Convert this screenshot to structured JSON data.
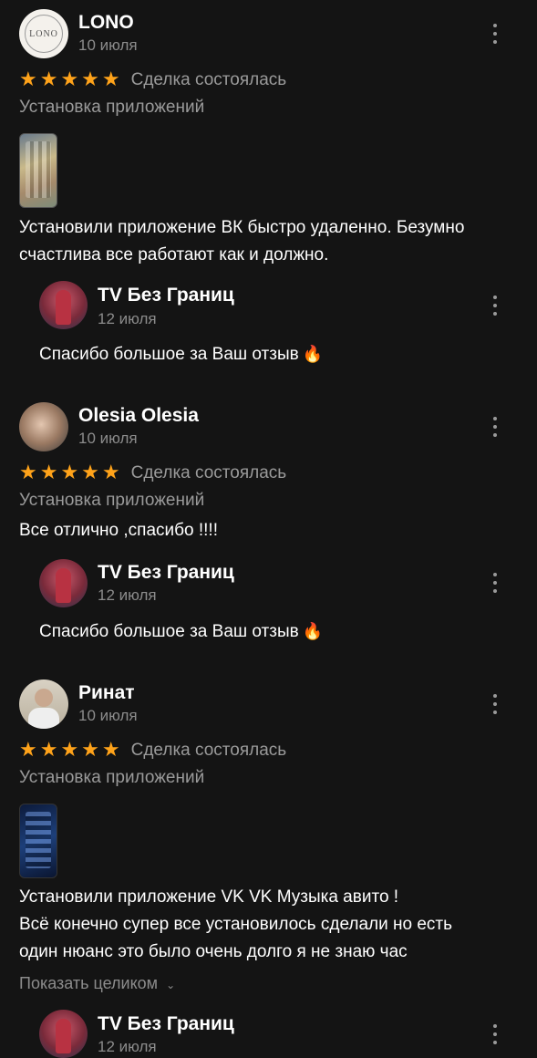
{
  "colors": {
    "background": "#141414",
    "star": "#ffa31a",
    "muted": "#9a9a9a"
  },
  "reviews": [
    {
      "author": "LONO",
      "avatar_text": "LONO",
      "date": "10 июля",
      "stars": "★★★★★",
      "deal_status": "Сделка состоялась",
      "category": "Установка приложений",
      "text_lines": [
        "Установили приложение ВК быстро удаленно. Безумно",
        "счастлива все работают как и должно."
      ],
      "reply": {
        "author": "TV Без Границ",
        "date": "12 июля",
        "text": "Спасибо большое за Ваш отзыв",
        "emoji": "🔥"
      }
    },
    {
      "author": "Olesia Olesia",
      "date": "10 июля",
      "stars": "★★★★★",
      "deal_status": "Сделка состоялась",
      "category": "Установка приложений",
      "text_lines": [
        "Все отлично ,спасибо !!!!"
      ],
      "reply": {
        "author": "TV Без Границ",
        "date": "12 июля",
        "text": "Спасибо большое за Ваш отзыв",
        "emoji": "🔥"
      }
    },
    {
      "author": "Ринат",
      "date": "10 июля",
      "stars": "★★★★★",
      "deal_status": "Сделка состоялась",
      "category": "Установка приложений",
      "text_lines": [
        "Установили приложение VK VK Музыка авито !",
        "Всё конечно супер все установилось сделали но есть",
        "один нюанс это было очень долго я не знаю час"
      ],
      "show_more": "Показать целиком",
      "reply": {
        "author": "TV Без Границ",
        "date": "12 июля"
      }
    }
  ]
}
